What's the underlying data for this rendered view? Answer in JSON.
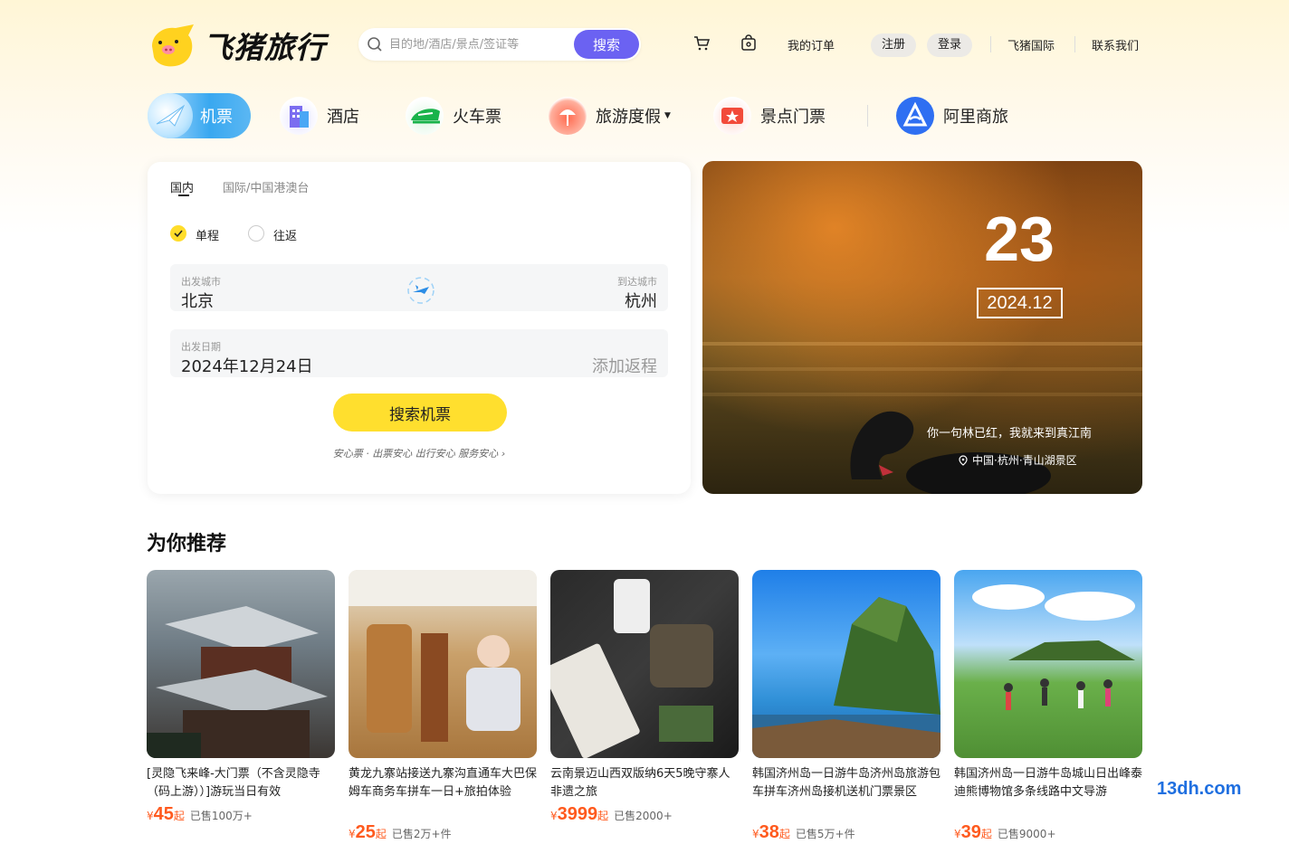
{
  "header": {
    "logo_text": "飞猪旅行",
    "search": {
      "placeholder": "目的地/酒店/景点/签证等",
      "button": "搜索"
    },
    "links": {
      "orders": "我的订单",
      "register": "注册",
      "login": "登录",
      "international": "飞猪国际",
      "contact": "联系我们"
    }
  },
  "nav": {
    "items": [
      {
        "label": "机票",
        "icon": "plane-icon"
      },
      {
        "label": "酒店",
        "icon": "hotel-icon"
      },
      {
        "label": "火车票",
        "icon": "train-icon"
      },
      {
        "label": "旅游度假",
        "icon": "vacation-icon"
      },
      {
        "label": "景点门票",
        "icon": "ticket-icon"
      },
      {
        "label": "阿里商旅",
        "icon": "business-icon"
      }
    ]
  },
  "flight": {
    "tabs": [
      "国内",
      "国际/中国港澳台"
    ],
    "trip_types": [
      "单程",
      "往返"
    ],
    "from_label": "出发城市",
    "from_value": "北京",
    "to_label": "到达城市",
    "to_value": "杭州",
    "date_label": "出发日期",
    "date_value": "2024年12月24日",
    "return_placeholder": "添加返程",
    "submit": "搜索机票",
    "tagline": "安心票 · 出票安心 出行安心 服务安心  ›"
  },
  "banner": {
    "day": "23",
    "year_month": "2024.12",
    "quote": "你一句林已红，我就来到真江南",
    "location": "中国·杭州·青山湖景区"
  },
  "recommend": {
    "title": "为你推荐",
    "cards": [
      {
        "title": "[灵隐飞来峰-大门票（不含灵隐寺（码上游））]游玩当日有效",
        "currency": "¥",
        "price": "45",
        "qi": "起",
        "sold": "已售100万+"
      },
      {
        "title": "黄龙九寨站接送九寨沟直通车大巴保姆车商务车拼车一日+旅拍体验",
        "currency": "¥",
        "price": "25",
        "qi": "起",
        "sold": "已售2万+件"
      },
      {
        "title": "云南景迈山西双版纳6天5晚守寨人非遗之旅",
        "currency": "¥",
        "price": "3999",
        "qi": "起",
        "sold": "已售2000+"
      },
      {
        "title": "韩国济州岛一日游牛岛济州岛旅游包车拼车济州岛接机送机门票景区",
        "currency": "¥",
        "price": "38",
        "qi": "起",
        "sold": "已售5万+件"
      },
      {
        "title": "韩国济州岛一日游牛岛城山日出峰泰迪熊博物馆多条线路中文导游",
        "currency": "¥",
        "price": "39",
        "qi": "起",
        "sold": "已售9000+"
      }
    ]
  },
  "watermark": "13dh.com"
}
